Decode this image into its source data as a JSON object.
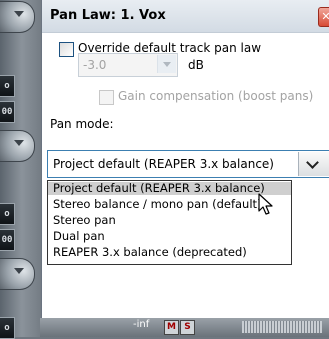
{
  "dialog": {
    "title": "Pan Law: 1. Vox",
    "close_glyph": "✕",
    "override_checkbox": {
      "label": "Override default track pan law",
      "checked": false
    },
    "pan_law": {
      "value": "-3.0",
      "unit": "dB"
    },
    "gain_comp_checkbox": {
      "label": "Gain compensation (boost pans)",
      "checked": false,
      "disabled": true
    },
    "pan_mode_label": "Pan mode:",
    "pan_mode_select": {
      "value": "Project default (REAPER 3.x balance)"
    },
    "dropdown_options": [
      "Project default (REAPER 3.x balance)",
      "Stereo balance / mono pan (default)",
      "Stereo pan",
      "Dual pan",
      "REAPER 3.x balance (deprecated)"
    ],
    "selected_index": 0
  },
  "background": {
    "volume_readout": "-inf",
    "mute_label": "M",
    "solo_label": "S",
    "led_labels": [
      "o",
      "00",
      "o",
      "00",
      "o"
    ]
  }
}
